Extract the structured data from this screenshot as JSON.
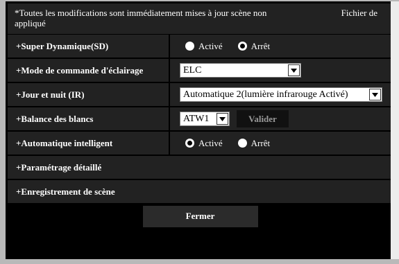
{
  "notice": {
    "message": "*Toutes les modifications sont immédiatement mises à jour scène non appliqué",
    "scene_file": "Fichier de"
  },
  "rows": {
    "super_dynamic": {
      "label": "+Super Dynamique(SD)",
      "options": [
        "Activé",
        "Arrêt"
      ],
      "selected": "Arrêt"
    },
    "light_control": {
      "label": "+Mode de commande d'éclairage",
      "value": "ELC"
    },
    "day_night": {
      "label": "+Jour et nuit (IR)",
      "value": "Automatique 2(lumière infrarouge Activé)"
    },
    "white_balance": {
      "label": "+Balance des blancs",
      "value": "ATW1",
      "button": "Valider"
    },
    "intelligent_auto": {
      "label": "+Automatique intelligent",
      "options": [
        "Activé",
        "Arrêt"
      ],
      "selected": "Activé"
    },
    "detailed_settings": {
      "label": "+Paramétrage détaillé"
    },
    "scene_save": {
      "label": "+Enregistrement de scène"
    }
  },
  "footer": {
    "close_label": "Fermer"
  },
  "icons": {
    "select_arrow": "chevron-down-icon",
    "radio": "radio-icon"
  },
  "colors": {
    "background": "#000000",
    "row": "#222222",
    "text": "#ffffff",
    "disabled_button": "#999999"
  }
}
